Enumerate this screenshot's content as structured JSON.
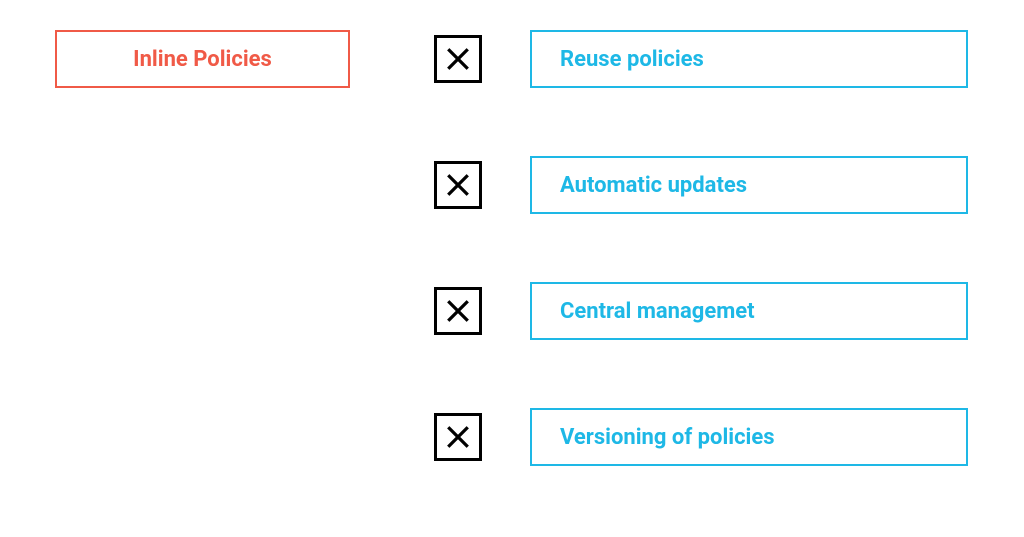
{
  "source": {
    "label": "Inline Policies"
  },
  "features": [
    {
      "label": "Reuse policies"
    },
    {
      "label": "Automatic updates"
    },
    {
      "label": "Central managemet"
    },
    {
      "label": "Versioning of policies"
    }
  ],
  "colors": {
    "source_border": "#f05a47",
    "feature_border": "#1eb8e6",
    "x_border": "#000000"
  }
}
